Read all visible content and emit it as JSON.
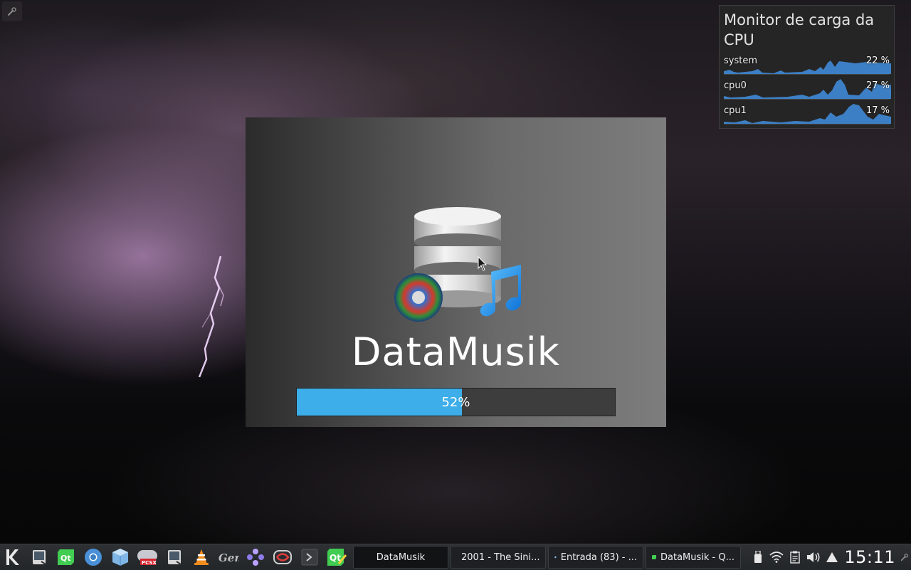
{
  "desktop": {
    "toolbox_icon": "wrench-icon"
  },
  "cpu_monitor": {
    "title": "Monitor de carga da CPU",
    "rows": [
      {
        "label": "system",
        "value": "22 %",
        "percent": 22
      },
      {
        "label": "cpu0",
        "value": "27 %",
        "percent": 27
      },
      {
        "label": "cpu1",
        "value": "17 %",
        "percent": 17
      }
    ],
    "graph_color": "#3d7fc4"
  },
  "splash": {
    "app_name": "DataMusik",
    "progress_text": "52%",
    "progress_fraction": 0.52,
    "progress_color": "#3daee9"
  },
  "taskbar": {
    "launcher_icon": "kde-logo-icon",
    "pinned": [
      "screenshot-app-icon",
      "qt-creator-icon",
      "chromium-icon",
      "virtualbox-icon",
      "pcsx-icon",
      "screenshot-app-icon-2",
      "vlc-icon",
      "gens-icon",
      "game-emulator-icon",
      "python-icon",
      "terminal-icon",
      "qt-designer-icon"
    ],
    "tasks": [
      {
        "label": "DataMusik",
        "icon": "",
        "active": true
      },
      {
        "label": "2001 - The Sini...",
        "icon": "folder-icon",
        "active": false
      },
      {
        "label": "Entrada (83) - ...",
        "icon": "chromium-icon",
        "active": false
      },
      {
        "label": "DataMusik - Q...",
        "icon": "qt-creator-icon",
        "active": false
      }
    ],
    "tray": [
      "usb-device-icon",
      "wifi-icon",
      "clipboard-icon",
      "volume-icon",
      "expand-tray-icon"
    ],
    "clock": "15:11"
  }
}
